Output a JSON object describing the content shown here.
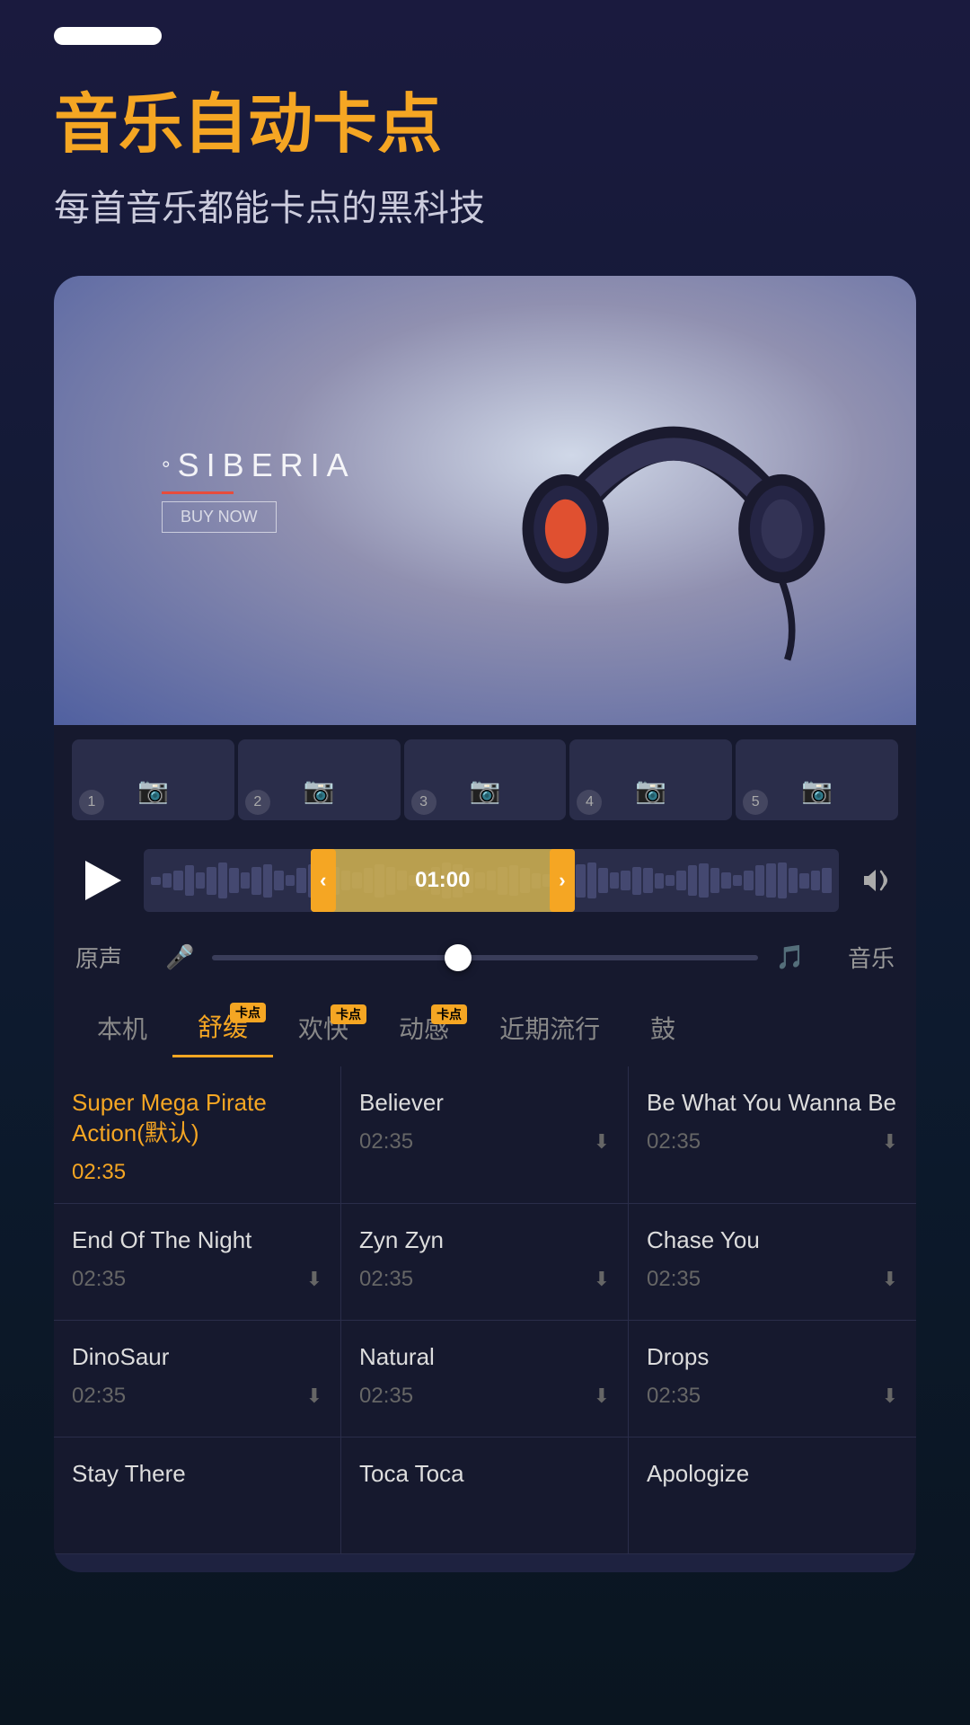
{
  "statusBar": {
    "pillVisible": true
  },
  "header": {
    "title": "音乐自动卡点",
    "subtitle": "每首音乐都能卡点的黑科技"
  },
  "brand": {
    "degree": "°",
    "name": "SIBERIA",
    "buttonLabel": "BUY NOW"
  },
  "timeline": {
    "thumbs": [
      {
        "number": "1"
      },
      {
        "number": "2"
      },
      {
        "number": "3"
      },
      {
        "number": "4"
      },
      {
        "number": "5"
      }
    ]
  },
  "waveform": {
    "currentTime": "01:00",
    "bars": [
      2,
      4,
      6,
      8,
      5,
      7,
      9,
      6,
      4,
      7,
      8,
      5,
      3,
      6,
      8,
      9,
      7,
      5,
      4,
      6,
      8,
      7,
      5,
      3,
      5,
      7,
      9,
      8,
      6,
      4,
      5,
      7,
      8,
      6,
      4,
      3,
      5,
      7,
      8,
      9,
      6,
      4,
      5,
      7,
      6,
      4,
      3,
      5,
      7,
      8,
      6,
      4,
      3,
      5,
      7,
      8,
      9,
      6,
      4,
      5,
      6
    ]
  },
  "balance": {
    "voiceLabel": "原声",
    "musicLabel": "音乐",
    "value": 45
  },
  "tabs": [
    {
      "label": "本机",
      "badge": null,
      "active": false
    },
    {
      "label": "舒缓",
      "badge": "卡点",
      "active": true
    },
    {
      "label": "欢快",
      "badge": "卡点",
      "active": false
    },
    {
      "label": "动感",
      "badge": "卡点",
      "active": false
    },
    {
      "label": "近期流行",
      "badge": null,
      "active": false
    },
    {
      "label": "鼓",
      "badge": null,
      "active": false
    }
  ],
  "musicList": [
    {
      "title": "Super Mega Pirate Action(默认)",
      "duration": "02:35",
      "hasDownload": false,
      "active": true
    },
    {
      "title": "Believer",
      "duration": "02:35",
      "hasDownload": true,
      "active": false
    },
    {
      "title": "Be What You Wanna Be",
      "duration": "02:35",
      "hasDownload": true,
      "active": false
    },
    {
      "title": "End Of The Night",
      "duration": "02:35",
      "hasDownload": true,
      "active": false
    },
    {
      "title": "Zyn Zyn",
      "duration": "02:35",
      "hasDownload": true,
      "active": false
    },
    {
      "title": "Chase You",
      "duration": "02:35",
      "hasDownload": true,
      "active": false
    },
    {
      "title": "DinoSaur",
      "duration": "02:35",
      "hasDownload": true,
      "active": false
    },
    {
      "title": "Natural",
      "duration": "02:35",
      "hasDownload": true,
      "active": false
    },
    {
      "title": "Drops",
      "duration": "02:35",
      "hasDownload": true,
      "active": false
    },
    {
      "title": "Stay There",
      "duration": "",
      "hasDownload": false,
      "active": false
    },
    {
      "title": "Toca Toca",
      "duration": "",
      "hasDownload": false,
      "active": false
    },
    {
      "title": "Apologize",
      "duration": "",
      "hasDownload": false,
      "active": false
    }
  ]
}
